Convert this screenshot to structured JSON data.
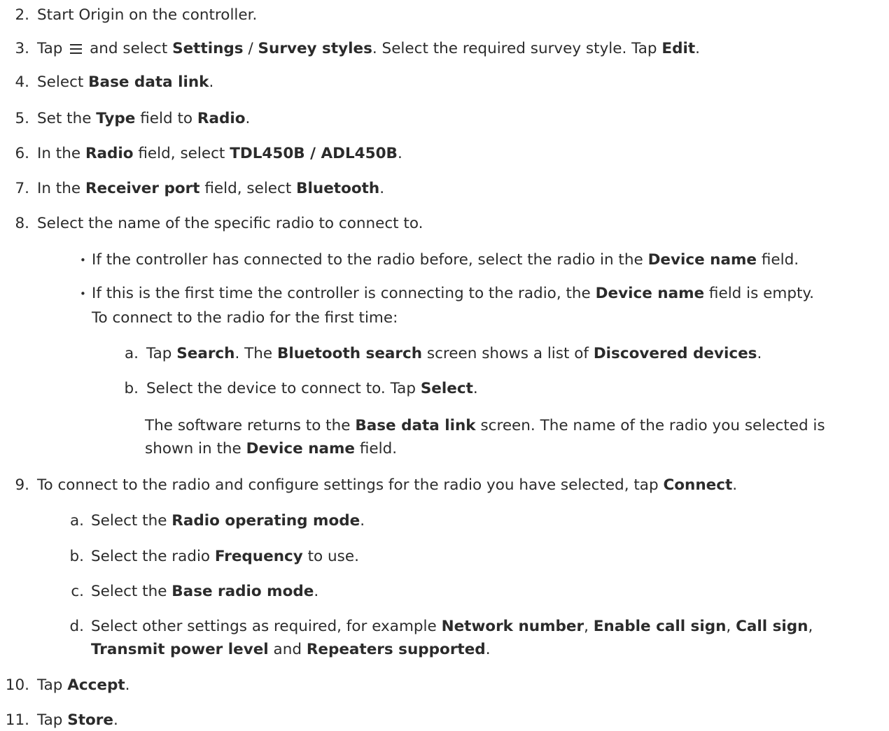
{
  "steps": [
    {
      "number": "2.",
      "parts": [
        "Start Origin on the controller."
      ]
    },
    {
      "number": "3.",
      "parts": [
        "Tap",
        "and select",
        "Settings",
        "/",
        "Survey styles",
        ". Select the required survey style. Tap",
        "Edit",
        "."
      ],
      "icon": "menu-icon"
    },
    {
      "number": "4.",
      "parts": [
        "Select",
        "Base data link",
        "."
      ]
    },
    {
      "number": "5.",
      "parts": [
        "Set the",
        "Type",
        "field to",
        "Radio",
        "."
      ]
    },
    {
      "number": "6.",
      "parts": [
        "In the",
        "Radio",
        "field, select",
        "TDL450B / ADL450B",
        "."
      ]
    },
    {
      "number": "7.",
      "parts": [
        "In the",
        "Receiver port",
        "field, select",
        "Bluetooth",
        "."
      ]
    },
    {
      "number": "8.",
      "parts": [
        "Select the name of the specific radio to connect to."
      ],
      "bullets": [
        {
          "parts": [
            "If the controller has connected to the radio before, select the radio in the",
            "Device name",
            "field."
          ]
        },
        {
          "parts": [
            "If this is the first time the controller is connecting to the radio, the",
            "Device name",
            "field is empty.",
            "To connect to the radio for the first time:"
          ],
          "substeps": [
            {
              "letter": "a.",
              "parts": [
                "Tap",
                "Search",
                ". The",
                "Bluetooth search",
                "screen shows a list of",
                "Discovered devices",
                "."
              ]
            },
            {
              "letter": "b.",
              "parts": [
                "Select the device to connect to. Tap",
                "Select",
                "."
              ],
              "note": [
                "The software returns to the",
                "Base data link",
                "screen. The name of the radio you selected is",
                "shown in the",
                "Device name",
                "field."
              ]
            }
          ]
        }
      ]
    },
    {
      "number": "9.",
      "parts": [
        "To connect to the radio and configure settings for the radio you have selected, tap",
        "Connect",
        "."
      ],
      "substeps": [
        {
          "letter": "a.",
          "parts": [
            "Select the",
            "Radio operating mode",
            "."
          ]
        },
        {
          "letter": "b.",
          "parts": [
            "Select the radio",
            "Frequency",
            "to use."
          ]
        },
        {
          "letter": "c.",
          "parts": [
            "Select the",
            "Base radio mode",
            "."
          ]
        },
        {
          "letter": "d.",
          "parts": [
            "Select other settings as required, for example",
            "Network number",
            ",",
            "Enable call sign",
            ",",
            "Call sign",
            ",",
            "Transmit power level",
            "and",
            "Repeaters supported",
            "."
          ]
        }
      ]
    },
    {
      "number": "10.",
      "parts": [
        "Tap",
        "Accept",
        "."
      ]
    },
    {
      "number": "11.",
      "parts": [
        "Tap",
        "Store",
        "."
      ]
    }
  ]
}
